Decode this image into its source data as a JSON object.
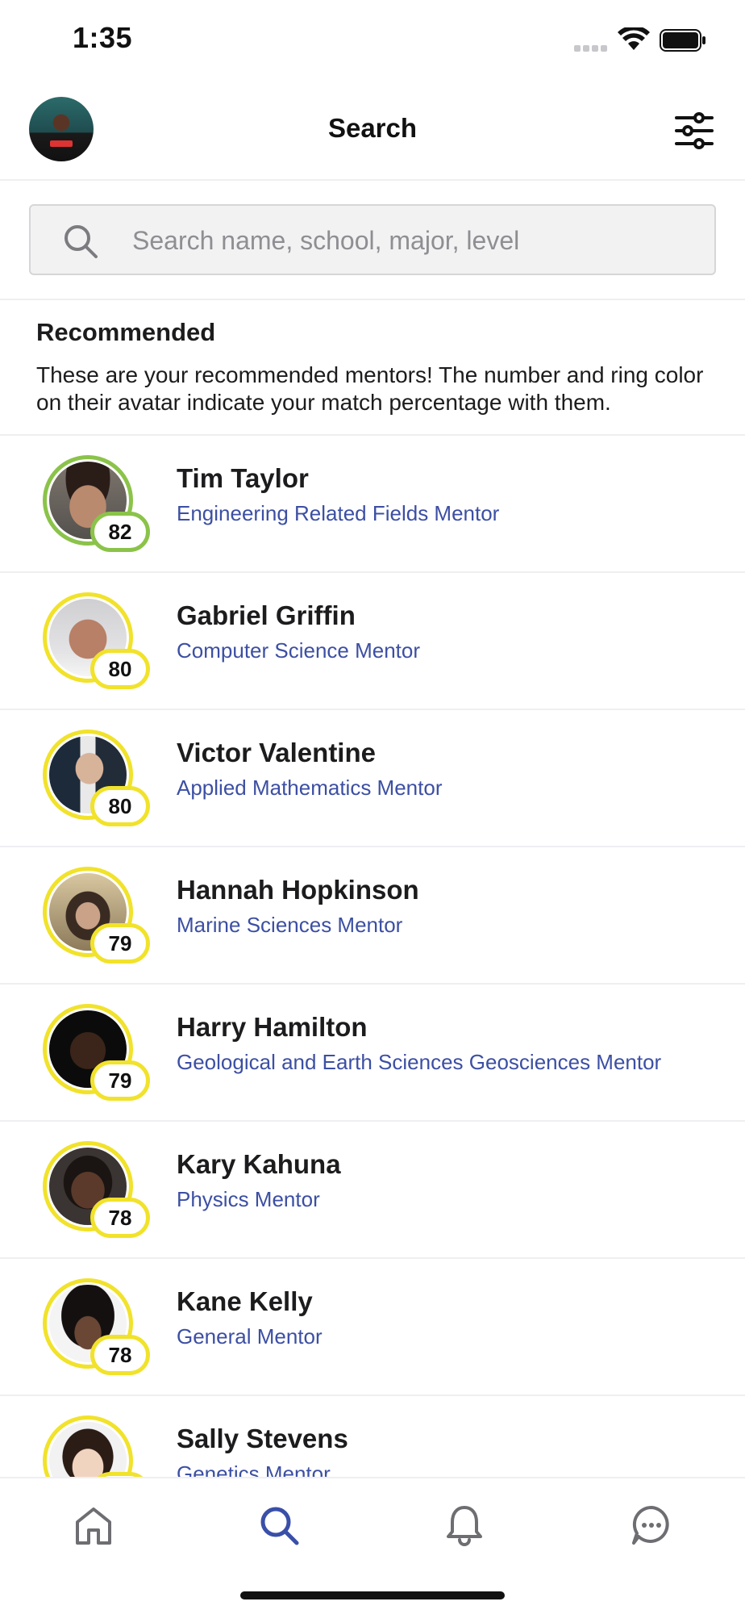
{
  "status_bar": {
    "time": "1:35"
  },
  "header": {
    "title": "Search"
  },
  "search": {
    "placeholder": "Search name, school, major, level"
  },
  "recommended": {
    "title": "Recommended",
    "description": "These are your recommended mentors! The number and ring color on their avatar indicate your match percentage with them."
  },
  "colors": {
    "ring_green": "#8bc34a",
    "ring_yellow": "#f1e22b",
    "role_text": "#3c4fa3",
    "active_tab": "#3a4fa8"
  },
  "mentors": [
    {
      "name": "Tim Taylor",
      "role": "Engineering Related Fields Mentor",
      "match": "82"
    },
    {
      "name": "Gabriel Griffin",
      "role": "Computer Science Mentor",
      "match": "80"
    },
    {
      "name": "Victor Valentine",
      "role": "Applied Mathematics Mentor",
      "match": "80"
    },
    {
      "name": "Hannah Hopkinson",
      "role": "Marine Sciences Mentor",
      "match": "79"
    },
    {
      "name": "Harry Hamilton",
      "role": "Geological and Earth Sciences Geosciences Mentor",
      "match": "79"
    },
    {
      "name": "Kary Kahuna",
      "role": "Physics Mentor",
      "match": "78"
    },
    {
      "name": "Kane Kelly",
      "role": "General Mentor",
      "match": "78"
    },
    {
      "name": "Sally Stevens",
      "role": "Genetics Mentor",
      "match": ""
    }
  ],
  "tabs": [
    {
      "icon": "home-icon"
    },
    {
      "icon": "search-icon",
      "active": true
    },
    {
      "icon": "bell-icon"
    },
    {
      "icon": "chat-icon"
    }
  ]
}
